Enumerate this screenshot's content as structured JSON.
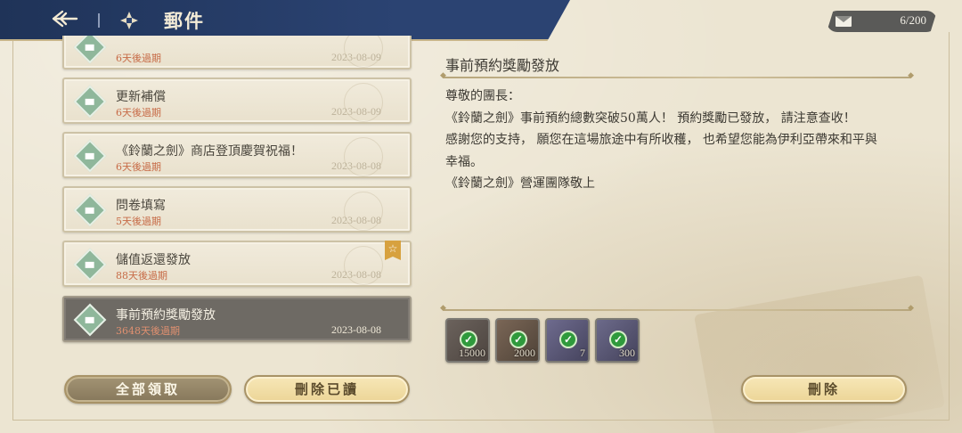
{
  "header": {
    "title": "郵件",
    "back_icon": "back-arrow-icon",
    "mail_icon": "mail-emblem-icon"
  },
  "mail_count": {
    "icon": "envelope-icon",
    "text": "6/200"
  },
  "mail_list": [
    {
      "title": "",
      "expire": "6天後過期",
      "date": "2023-08-09",
      "starred": false,
      "active": false
    },
    {
      "title": "更新補償",
      "expire": "6天後過期",
      "date": "2023-08-09",
      "starred": false,
      "active": false
    },
    {
      "title": "《鈴蘭之劍》商店登頂慶賀祝福！",
      "expire": "6天後過期",
      "date": "2023-08-08",
      "starred": false,
      "active": false
    },
    {
      "title": "問卷填寫",
      "expire": "5天後過期",
      "date": "2023-08-08",
      "starred": false,
      "active": false
    },
    {
      "title": "儲值返還發放",
      "expire": "88天後過期",
      "date": "2023-08-08",
      "starred": true,
      "active": false
    },
    {
      "title": "事前預約獎勵發放",
      "expire": "3648天後過期",
      "date": "2023-08-08",
      "starred": false,
      "active": true
    }
  ],
  "buttons": {
    "claim_all": "全部領取",
    "delete_read": "刪除已讀",
    "delete": "刪除"
  },
  "detail": {
    "title": "事前預約獎勵發放",
    "body": [
      "尊敬的團長：",
      "《鈴蘭之劍》事前預約總數突破50萬人！ 預約獎勵已發放， 請注意查收！",
      "感謝您的支持， 願您在這場旅途中有所收穫， 也希望您能為伊利亞帶來和平與",
      "幸福。",
      "《鈴蘭之劍》營運團隊敬上"
    ]
  },
  "rewards": [
    {
      "qty": "15000",
      "claimed": true,
      "color": "#5e5650"
    },
    {
      "qty": "2000",
      "claimed": true,
      "color": "#6a5a4c"
    },
    {
      "qty": "7",
      "claimed": true,
      "color": "#5d5a78"
    },
    {
      "qty": "300",
      "claimed": true,
      "color": "#5c5a74"
    }
  ],
  "colors": {
    "header_bg": "#23385f",
    "expire_text": "#c76b47",
    "active_item": "#6e6a64"
  }
}
